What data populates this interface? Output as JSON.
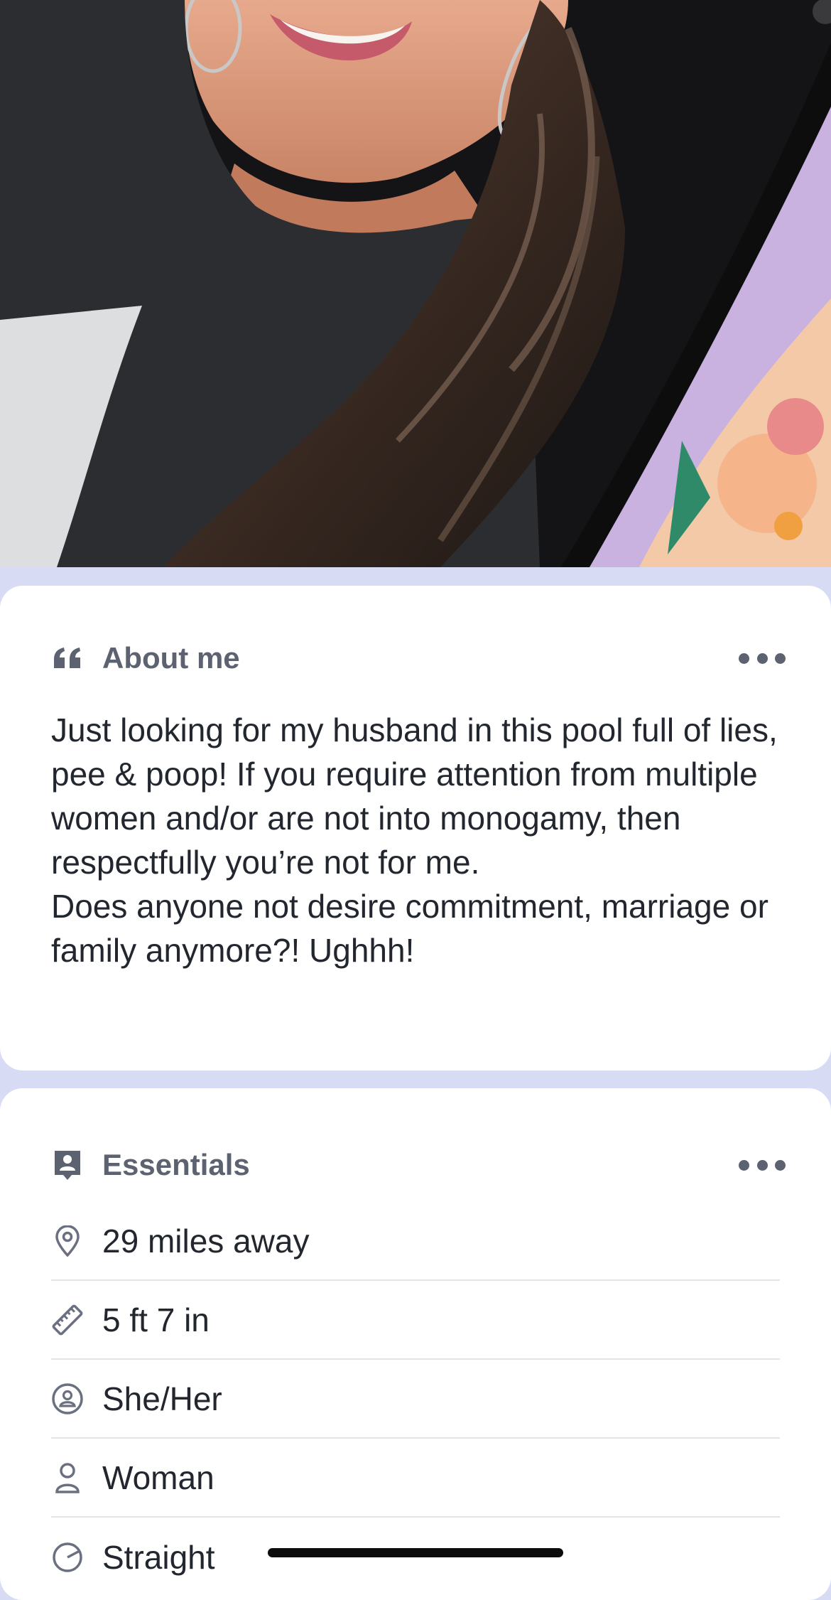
{
  "about": {
    "title": "About me",
    "paragraph1": "Just looking for my husband in this pool full of lies, pee & poop! If you require attention from multiple women and/or are not into monogamy, then respectfully you’re not for me.",
    "paragraph2": "Does anyone not desire commitment, marriage or family anymore?! Ughhh!"
  },
  "essentials": {
    "title": "Essentials",
    "items": [
      {
        "icon": "location-pin-icon",
        "label": "29 miles away"
      },
      {
        "icon": "ruler-icon",
        "label": "5 ft 7 in"
      },
      {
        "icon": "pronouns-icon",
        "label": "She/Her"
      },
      {
        "icon": "person-icon",
        "label": "Woman"
      },
      {
        "icon": "orientation-icon",
        "label": "Straight"
      }
    ]
  },
  "colors": {
    "page_background": "#d7dcf4",
    "card_background": "#ffffff",
    "header_text": "#5c6270",
    "body_text": "#22262e"
  }
}
